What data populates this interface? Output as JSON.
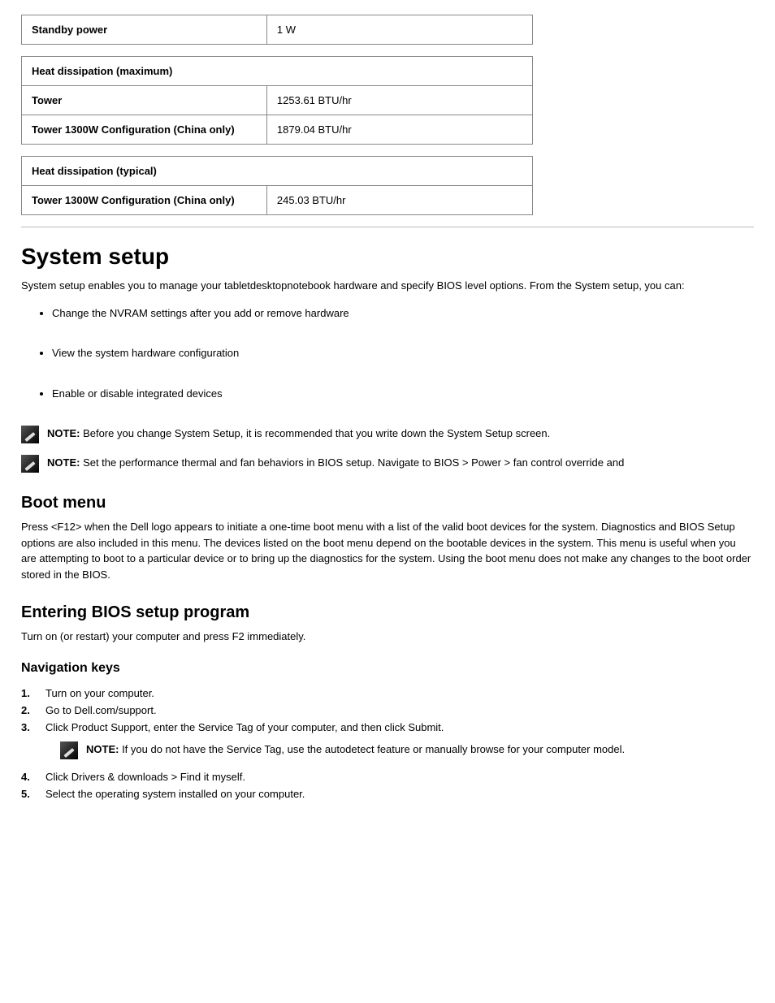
{
  "table1": {
    "row0_label": "Standby power",
    "row0_value": "1 W"
  },
  "table2": {
    "header": "Heat dissipation (maximum)",
    "row0_label": "Tower",
    "row0_value": "1253.61 BTU/hr",
    "row1_label": "Tower 1300W Configuration (China only)",
    "row1_value": "1879.04 BTU/hr"
  },
  "table3": {
    "header": "Heat dissipation (typical)",
    "row0_label": "Tower 1300W Configuration (China only)",
    "row0_value": "245.03 BTU/hr"
  },
  "h1": "System setup",
  "intro": "System setup enables you to manage your tabletdesktopnotebook hardware and specify BIOS level options. From the System setup, you can:",
  "bullets": {
    "b0": "Change the NVRAM settings after you add or remove hardware",
    "b1": "View the system hardware configuration",
    "b2": "Enable or disable integrated devices"
  },
  "note1_label": "NOTE: ",
  "note1_text": "Before you change System Setup, it is recommended that you write down the System Setup screen.",
  "note2_label": "NOTE: ",
  "note2_text": "Set the performance thermal and fan behaviors in BIOS setup. Navigate to BIOS > Power > fan control override and",
  "h2": "Boot menu",
  "boot_para1": "Press <F12> when the Dell logo appears to initiate a one-time boot menu with a list of the valid boot devices for the system. Diagnostics and BIOS Setup options are also included in this menu. The devices listed on the boot menu depend on the bootable devices in the system. This menu is useful when you are attempting to boot to a particular device or to bring up the diagnostics for the system. Using the boot menu does not make any changes to the boot order stored in the BIOS.",
  "h2b": "Entering BIOS setup program",
  "boot_para2": "Turn on (or restart) your computer and press F2 immediately.",
  "h3": "Navigation keys",
  "steps": {
    "num1": "1.",
    "body1": "Turn on your computer.",
    "num2": "2.",
    "body2": "Go to Dell.com/support.",
    "num3": "3.",
    "body3": "Click Product Support, enter the Service Tag of your computer, and then click Submit.",
    "sub_note_label": "NOTE: ",
    "sub_note_text": "If you do not have the Service Tag, use the autodetect feature or manually browse for your computer model.",
    "num4": "4.",
    "body4": "Click Drivers & downloads > Find it myself.",
    "num5": "5.",
    "body5": "Select the operating system installed on your computer."
  }
}
